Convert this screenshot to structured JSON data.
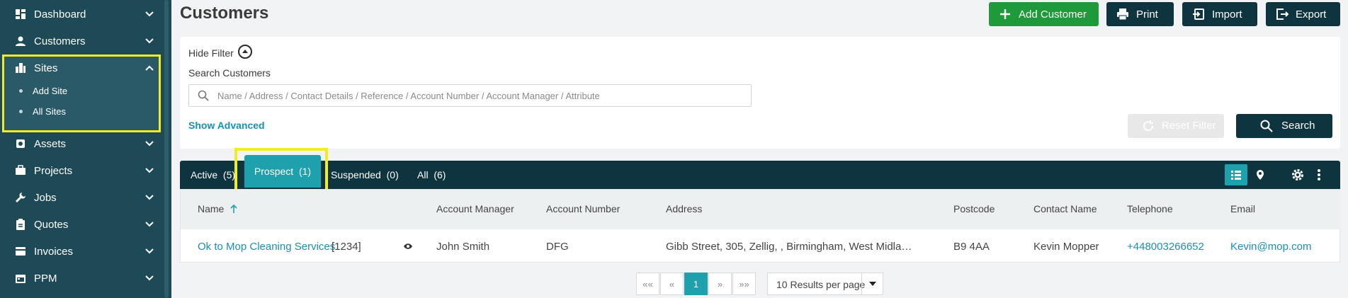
{
  "sidebar": {
    "items": [
      {
        "label": "Dashboard",
        "icon": "dashboard-icon"
      },
      {
        "label": "Customers",
        "icon": "person-icon"
      },
      {
        "label": "Sites",
        "icon": "building-icon"
      },
      {
        "label": "Assets",
        "icon": "asset-icon"
      },
      {
        "label": "Projects",
        "icon": "briefcase-icon"
      },
      {
        "label": "Jobs",
        "icon": "wrench-icon"
      },
      {
        "label": "Quotes",
        "icon": "clipboard-icon"
      },
      {
        "label": "Invoices",
        "icon": "invoice-icon"
      },
      {
        "label": "PPM",
        "icon": "calendar-icon"
      }
    ],
    "sites_sub": [
      {
        "label": "Add Site"
      },
      {
        "label": "All Sites"
      }
    ]
  },
  "header": {
    "title": "Customers",
    "add_customer": "Add Customer",
    "print": "Print",
    "import": "Import",
    "export": "Export"
  },
  "filter": {
    "hide_filter": "Hide Filter",
    "search_label": "Search Customers",
    "search_placeholder": "Name / Address / Contact Details / Reference / Account Number / Account Manager / Attribute",
    "show_advanced": "Show Advanced",
    "reset": "Reset Filter",
    "search": "Search"
  },
  "tabs": [
    {
      "label": "Active",
      "count": "(5)"
    },
    {
      "label": "Prospect",
      "count": "(1)"
    },
    {
      "label": "Suspended",
      "count": "(0)"
    },
    {
      "label": "All",
      "count": "(6)"
    }
  ],
  "table": {
    "columns": [
      "Name",
      "Account Manager",
      "Account Number",
      "Address",
      "Postcode",
      "Contact Name",
      "Telephone",
      "Email"
    ],
    "rows": [
      {
        "name": "Ok to Mop Cleaning Services",
        "ref": "[1234]",
        "account_manager": "John Smith",
        "account_number": "DFG",
        "address": "Gibb Street, 305, Zellig, , Birmingham, West Midla…",
        "postcode": "B9 4AA",
        "contact_name": "Kevin Mopper",
        "telephone": "+448003266652",
        "email": "Kevin@mop.com"
      }
    ]
  },
  "pagination": {
    "first": "««",
    "prev": "«",
    "current": "1",
    "next": "»",
    "last": "»»",
    "per_page": "10 Results per page"
  },
  "colors": {
    "sidebar": "#1e4a57",
    "dark": "#0e3440",
    "accent": "#1fa0ad",
    "add": "#1f9a3a",
    "link": "#1a8fb3",
    "highlight": "#f2ec20"
  }
}
